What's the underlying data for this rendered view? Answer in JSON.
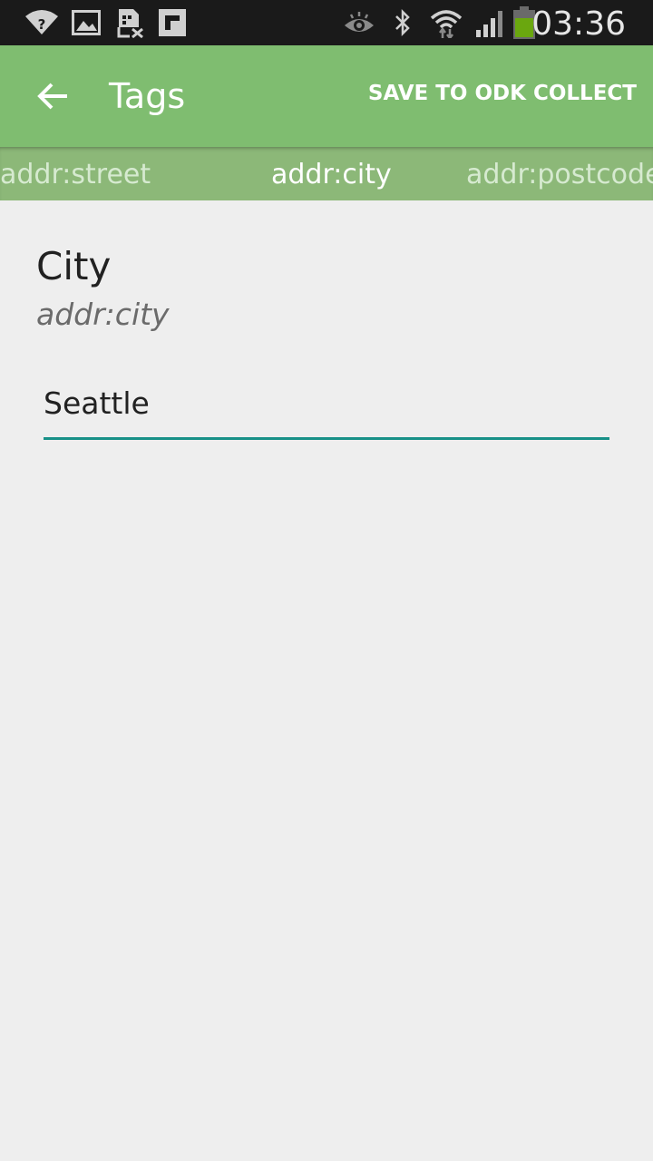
{
  "status_bar": {
    "time": "03:36",
    "icons": [
      "wifi-question-icon",
      "image-icon",
      "sim-error-icon",
      "flipboard-icon",
      "eye-icon",
      "bluetooth-icon",
      "wifi-transfer-icon",
      "signal-icon",
      "battery-icon"
    ],
    "battery_color": "#6aa70f"
  },
  "app_bar": {
    "title": "Tags",
    "action_label": "SAVE TO ODK COLLECT",
    "background": "#7fbd70"
  },
  "tabs": [
    {
      "label": "addr:street",
      "active": false
    },
    {
      "label": "addr:city",
      "active": true
    },
    {
      "label": "addr:postcode",
      "active": false
    }
  ],
  "field": {
    "title": "City",
    "key": "addr:city",
    "value": "Seattle",
    "underline_color": "#179087"
  }
}
